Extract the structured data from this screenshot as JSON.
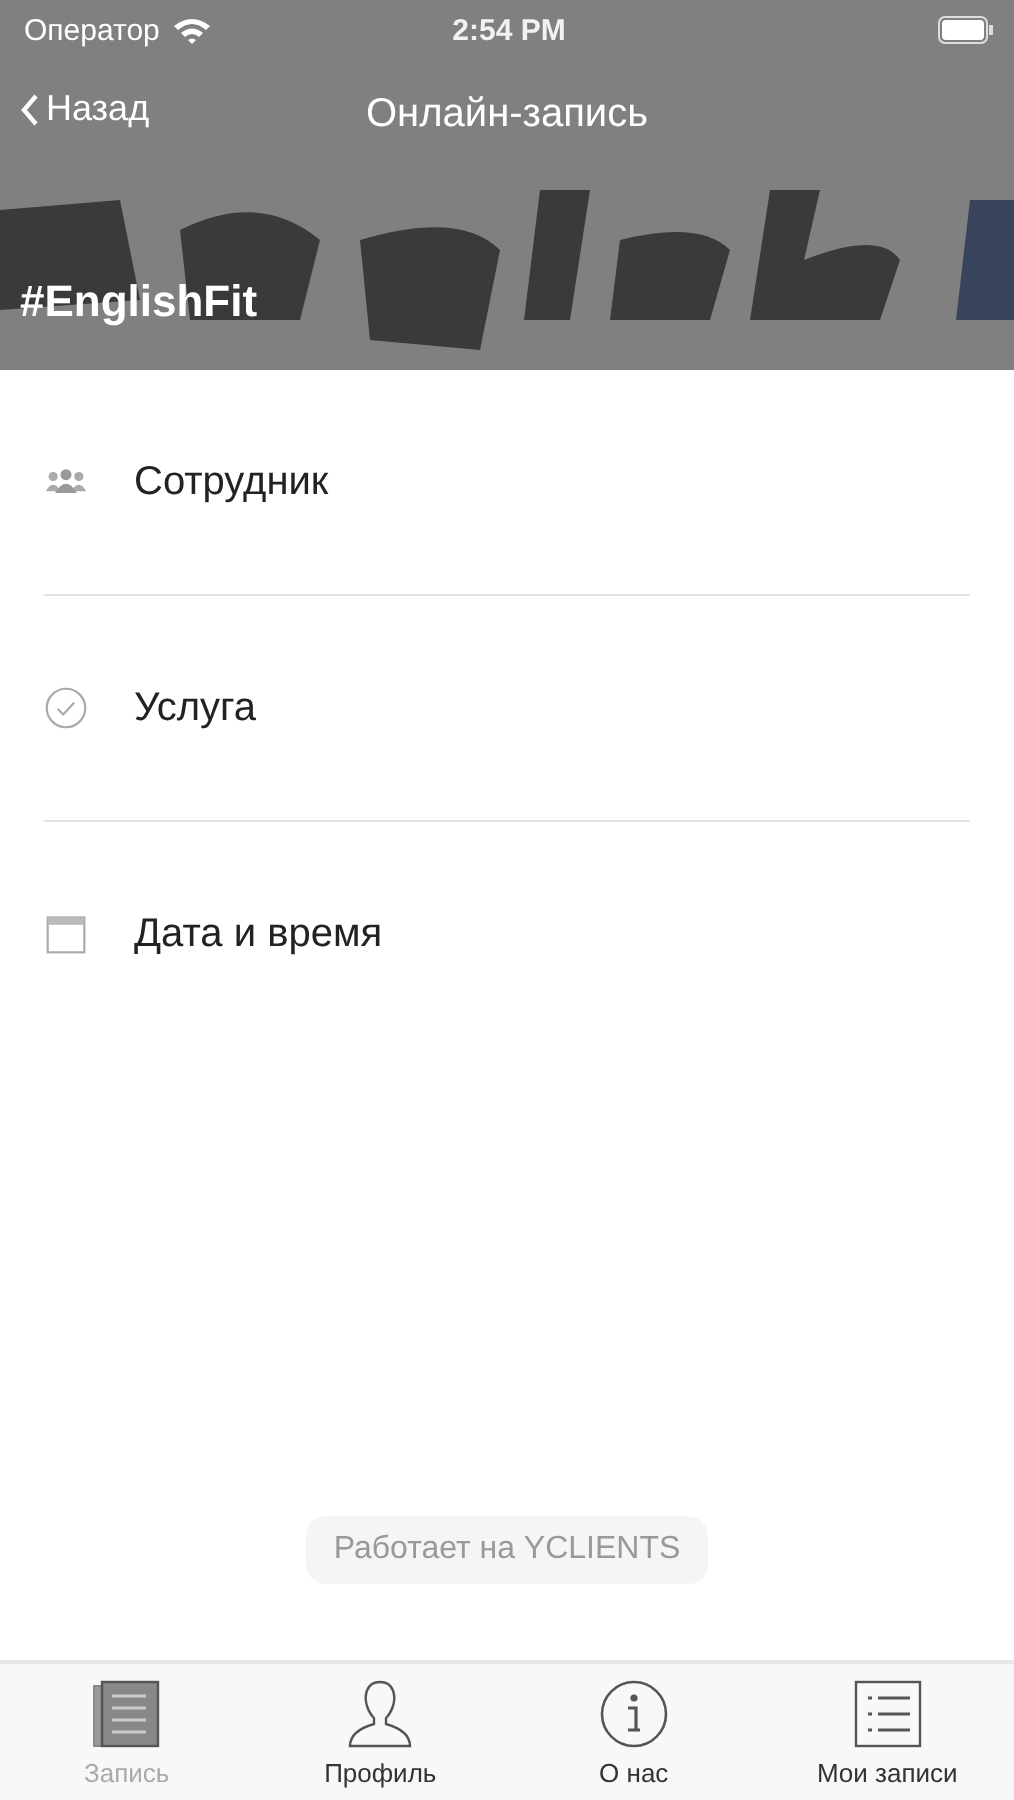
{
  "status_bar": {
    "carrier": "Оператор",
    "time": "2:54 PM"
  },
  "nav": {
    "back": "Назад",
    "title": "Онлайн-запись"
  },
  "header": {
    "kind": "picture",
    "caption": "#EnglishFit"
  },
  "menu": [
    {
      "label": "Сотрудник"
    },
    {
      "label": "Услуга"
    },
    {
      "label": "Дата и время"
    }
  ],
  "powered_by": "Работает на YCLIENTS",
  "tab_bar": [
    {
      "label": "Запись",
      "selected": true
    },
    {
      "label": "Профиль",
      "selected": false
    },
    {
      "label": "О нас",
      "selected": false
    },
    {
      "label": "Мои записи",
      "selected": false
    }
  ]
}
